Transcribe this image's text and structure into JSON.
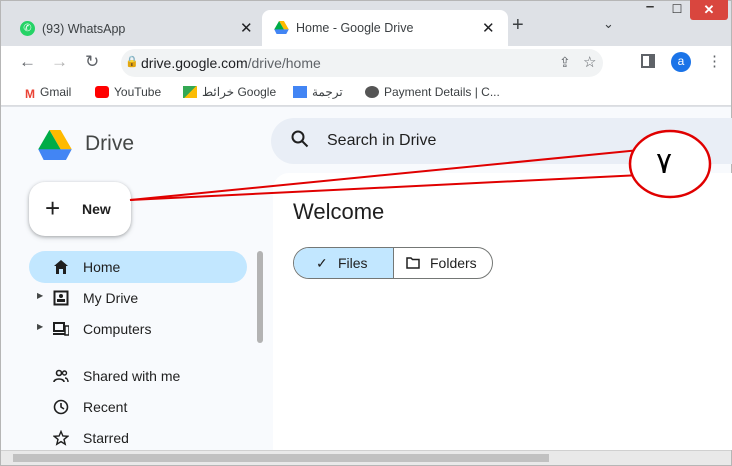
{
  "browser": {
    "tabs": [
      {
        "title": "(93) WhatsApp",
        "close": "✕",
        "active": false
      },
      {
        "title": "Home - Google Drive",
        "close": "✕",
        "active": true
      }
    ],
    "new_tab": "+",
    "tab_search": "⌄",
    "window": {
      "minimize": "–",
      "maximize": "☐",
      "close": "✕"
    },
    "url_domain": "drive.google.com",
    "url_path": "/drive/home",
    "avatar_letter": "a",
    "bookmarks": [
      "Gmail",
      "YouTube",
      "خرائط Google",
      "ترجمة",
      "Payment Details | C..."
    ]
  },
  "drive": {
    "logo_text": "Drive",
    "search_placeholder": "Search in Drive",
    "new_button": "New",
    "nav": [
      {
        "label": "Home",
        "icon": "home-icon",
        "active": true
      },
      {
        "label": "My Drive",
        "icon": "my-drive-icon",
        "active": false
      },
      {
        "label": "Computers",
        "icon": "computers-icon",
        "active": false
      },
      {
        "label": "Shared with me",
        "icon": "people-icon",
        "active": false
      },
      {
        "label": "Recent",
        "icon": "clock-icon",
        "active": false
      },
      {
        "label": "Starred",
        "icon": "star-icon",
        "active": false
      }
    ],
    "welcome": "Welcome",
    "filter": {
      "files": "Files",
      "folders": "Folders"
    }
  },
  "annotation": {
    "number": "٧",
    "color": "#e00000"
  },
  "colors": {
    "active_nav": "#c2e7ff",
    "search_bg": "#e9eef6",
    "accent": "#1a73e8"
  }
}
